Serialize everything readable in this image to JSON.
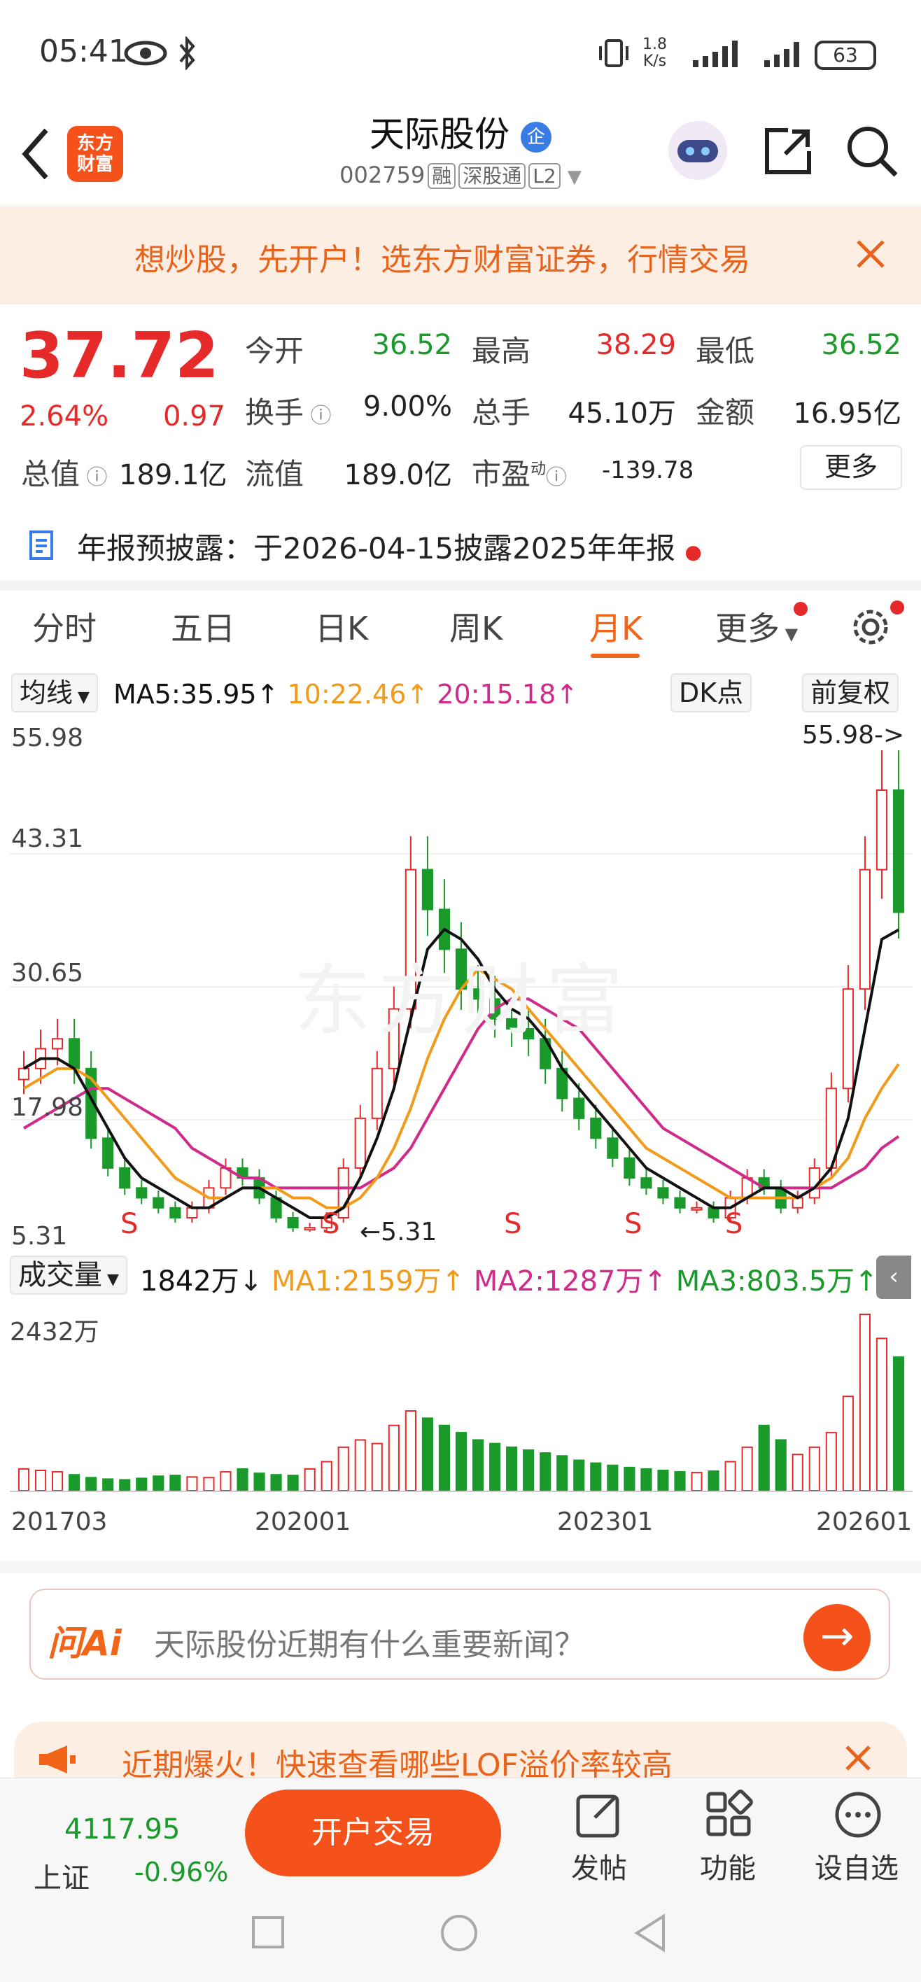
{
  "status": {
    "time": "05:41",
    "speed_value": "1.8",
    "speed_unit": "K/s",
    "battery": "63"
  },
  "header": {
    "logo_line1": "东方",
    "logo_line2": "财富",
    "title": "天际股份",
    "badge": "企",
    "code": "002759",
    "tags": [
      "融",
      "深股通",
      "L2"
    ]
  },
  "banner": {
    "text": "想炒股，先开户！选东方财富证券，行情交易"
  },
  "quote": {
    "price": "37.72",
    "pct": "2.64%",
    "change": "0.97",
    "open_label": "今开",
    "open": "36.52",
    "high_label": "最高",
    "high": "38.29",
    "low_label": "最低",
    "low": "36.52",
    "turnover_label": "换手",
    "turnover": "9.00%",
    "volume_label": "总手",
    "volume": "45.10万",
    "amount_label": "金额",
    "amount": "16.95亿",
    "mktcap_label": "总值",
    "mktcap": "189.1亿",
    "float_label": "流值",
    "float": "189.0亿",
    "pe_label": "市盈",
    "pe_sup": "动",
    "pe": "-139.78",
    "more": "更多"
  },
  "notice": {
    "text": "年报预披露：于2026-04-15披露2025年年报"
  },
  "tabs": [
    "分时",
    "五日",
    "日K",
    "周K",
    "月K",
    "更多"
  ],
  "active_tab": "月K",
  "ma_bar": {
    "selector": "均线",
    "ma5": "MA5:35.95",
    "ma10": "10:22.46",
    "ma20": "20:15.18",
    "dk": "DK点",
    "fq": "前复权"
  },
  "kline_axis": {
    "ticks": [
      "55.98",
      "43.31",
      "30.65",
      "17.98",
      "5.31"
    ],
    "max_marker": "55.98->",
    "min_marker": "5.31",
    "watermark": "东方财富",
    "signal": "S"
  },
  "volume_bar": {
    "selector": "成交量",
    "current": "1842万",
    "ma1": "MA1:2159万",
    "ma2": "MA2:1287万",
    "ma3": "MA3:803.5万",
    "max": "2432万"
  },
  "date_axis": [
    "201703",
    "202001",
    "202301",
    "202601"
  ],
  "colors": {
    "up": "#e62a2a",
    "down": "#1a9a2a",
    "ma5": "#111111",
    "ma10": "#f29a1a",
    "ma20": "#d02a8a",
    "accent": "#f26418"
  },
  "ai": {
    "logo": "问Ai",
    "placeholder": "天际股份近期有什么重要新闻？"
  },
  "ad": {
    "text": "近期爆火！快速查看哪些LOF溢价率较高"
  },
  "bottom": {
    "index_value": "4117.95",
    "index_name": "上证",
    "index_pct": "-0.96%",
    "trade": "开户交易",
    "post": "发帖",
    "func": "功能",
    "watch": "设自选"
  },
  "chart_data": {
    "type": "candlestick",
    "period": "monthly",
    "x_range": [
      "201703",
      "202601"
    ],
    "ylim": [
      5.31,
      55.98
    ],
    "close_series": [
      22,
      24,
      25,
      22,
      15,
      12,
      10,
      9,
      8,
      7,
      8,
      10,
      12,
      11,
      9,
      7,
      6,
      6,
      7,
      12,
      17,
      22,
      28,
      42,
      38,
      34,
      30,
      29,
      27,
      26,
      25,
      22,
      19,
      17,
      15,
      13,
      11,
      10,
      9,
      8,
      8,
      7,
      9,
      11,
      10,
      8,
      9,
      12,
      20,
      30,
      42,
      50,
      37.72
    ],
    "ma5_series": [
      22,
      23,
      23,
      22,
      19,
      16,
      13,
      11,
      10,
      9,
      8,
      8,
      9,
      10,
      10,
      9,
      8,
      7,
      7,
      8,
      11,
      15,
      20,
      27,
      34,
      36,
      35,
      33,
      30,
      28,
      27,
      25,
      22,
      20,
      18,
      16,
      14,
      12,
      11,
      10,
      9,
      8,
      8,
      9,
      10,
      10,
      9,
      10,
      12,
      17,
      26,
      35,
      35.95
    ],
    "ma10_series": [
      20,
      21,
      22,
      22,
      21,
      19,
      17,
      15,
      13,
      11,
      10,
      9,
      9,
      10,
      10,
      10,
      9,
      9,
      8,
      8,
      9,
      11,
      14,
      18,
      23,
      27,
      30,
      32,
      31,
      30,
      28,
      26,
      24,
      22,
      20,
      18,
      16,
      14,
      13,
      12,
      11,
      10,
      9,
      9,
      9,
      9,
      9,
      10,
      11,
      13,
      17,
      20,
      22.46
    ],
    "ma20_series": [
      16,
      17,
      18,
      19,
      20,
      20,
      19,
      18,
      17,
      16,
      14,
      13,
      12,
      11,
      11,
      10,
      10,
      10,
      10,
      10,
      10,
      11,
      12,
      14,
      17,
      20,
      23,
      26,
      28,
      29,
      29,
      28,
      27,
      26,
      24,
      22,
      20,
      18,
      16,
      15,
      14,
      13,
      12,
      11,
      10,
      10,
      10,
      10,
      10,
      11,
      12,
      14,
      15.18
    ],
    "volume_series": [
      300,
      280,
      260,
      220,
      180,
      160,
      150,
      170,
      200,
      210,
      190,
      180,
      260,
      300,
      240,
      220,
      210,
      300,
      400,
      600,
      700,
      650,
      900,
      1100,
      1000,
      900,
      800,
      700,
      650,
      600,
      560,
      520,
      480,
      420,
      380,
      350,
      320,
      300,
      280,
      260,
      250,
      270,
      400,
      600,
      900,
      700,
      500,
      600,
      800,
      1300,
      2432,
      2100,
      1842
    ],
    "volume_unit": "万"
  }
}
